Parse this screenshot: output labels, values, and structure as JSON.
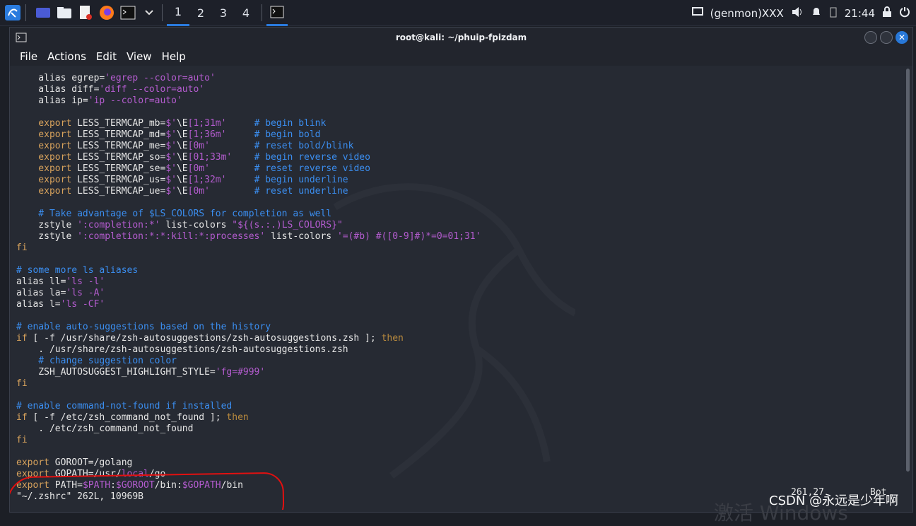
{
  "taskbar": {
    "workspaces": [
      "1",
      "2",
      "3",
      "4"
    ],
    "active_workspace": "1",
    "genmon": "(genmon)XXX",
    "clock": "21:44"
  },
  "window": {
    "title": "root@kali: ~/phuip-fpizdam",
    "menu": [
      "File",
      "Actions",
      "Edit",
      "View",
      "Help"
    ]
  },
  "lines": [
    [
      [
        "    alias egrep=",
        ""
      ],
      [
        "'egrep --color=auto'",
        "s"
      ]
    ],
    [
      [
        "    alias diff=",
        ""
      ],
      [
        "'diff --color=auto'",
        "s"
      ]
    ],
    [
      [
        "    alias ip=",
        ""
      ],
      [
        "'ip --color=auto'",
        "s"
      ]
    ],
    [],
    [
      [
        "    export ",
        "k"
      ],
      [
        "LESS_TERMCAP_mb=",
        ""
      ],
      [
        "$'",
        "s"
      ],
      [
        "\\E",
        ""
      ],
      [
        "[1;31m'",
        "s"
      ],
      [
        "     ",
        ""
      ],
      [
        "# begin blink",
        "c"
      ]
    ],
    [
      [
        "    export ",
        "k"
      ],
      [
        "LESS_TERMCAP_md=",
        ""
      ],
      [
        "$'",
        "s"
      ],
      [
        "\\E",
        ""
      ],
      [
        "[1;36m'",
        "s"
      ],
      [
        "     ",
        ""
      ],
      [
        "# begin bold",
        "c"
      ]
    ],
    [
      [
        "    export ",
        "k"
      ],
      [
        "LESS_TERMCAP_me=",
        ""
      ],
      [
        "$'",
        "s"
      ],
      [
        "\\E",
        ""
      ],
      [
        "[0m'",
        "s"
      ],
      [
        "        ",
        ""
      ],
      [
        "# reset bold/blink",
        "c"
      ]
    ],
    [
      [
        "    export ",
        "k"
      ],
      [
        "LESS_TERMCAP_so=",
        ""
      ],
      [
        "$'",
        "s"
      ],
      [
        "\\E",
        ""
      ],
      [
        "[01;33m'",
        "s"
      ],
      [
        "    ",
        ""
      ],
      [
        "# begin reverse video",
        "c"
      ]
    ],
    [
      [
        "    export ",
        "k"
      ],
      [
        "LESS_TERMCAP_se=",
        ""
      ],
      [
        "$'",
        "s"
      ],
      [
        "\\E",
        ""
      ],
      [
        "[0m'",
        "s"
      ],
      [
        "        ",
        ""
      ],
      [
        "# reset reverse video",
        "c"
      ]
    ],
    [
      [
        "    export ",
        "k"
      ],
      [
        "LESS_TERMCAP_us=",
        ""
      ],
      [
        "$'",
        "s"
      ],
      [
        "\\E",
        ""
      ],
      [
        "[1;32m'",
        "s"
      ],
      [
        "     ",
        ""
      ],
      [
        "# begin underline",
        "c"
      ]
    ],
    [
      [
        "    export ",
        "k"
      ],
      [
        "LESS_TERMCAP_ue=",
        ""
      ],
      [
        "$'",
        "s"
      ],
      [
        "\\E",
        ""
      ],
      [
        "[0m'",
        "s"
      ],
      [
        "        ",
        ""
      ],
      [
        "# reset underline",
        "c"
      ]
    ],
    [],
    [
      [
        "    # Take advantage of $LS_COLORS for completion as well",
        "c"
      ]
    ],
    [
      [
        "    zstyle ",
        ""
      ],
      [
        "':completion:*'",
        "s"
      ],
      [
        " list-colors ",
        ""
      ],
      [
        "\"${(s.:.)LS_COLORS}\"",
        "s"
      ]
    ],
    [
      [
        "    zstyle ",
        ""
      ],
      [
        "':completion:*:*:kill:*:processes'",
        "s"
      ],
      [
        " list-colors ",
        ""
      ],
      [
        "'=(#b) #([0-9]#)*=0=01;31'",
        "s"
      ]
    ],
    [
      [
        "fi",
        "k"
      ]
    ],
    [],
    [
      [
        "# some more ls aliases",
        "c"
      ]
    ],
    [
      [
        "alias ll=",
        ""
      ],
      [
        "'ls -l'",
        "s"
      ]
    ],
    [
      [
        "alias la=",
        ""
      ],
      [
        "'ls -A'",
        "s"
      ]
    ],
    [
      [
        "alias l=",
        ""
      ],
      [
        "'ls -CF'",
        "s"
      ]
    ],
    [],
    [
      [
        "# enable auto-suggestions based on the history",
        "c"
      ]
    ],
    [
      [
        "if",
        "k"
      ],
      [
        " [ -f /usr/share/zsh-autosuggestions/zsh-autosuggestions.zsh ]; ",
        ""
      ],
      [
        "then",
        "o"
      ]
    ],
    [
      [
        "    . /usr/share/zsh-autosuggestions/zsh-autosuggestions.zsh",
        ""
      ]
    ],
    [
      [
        "    # change suggestion color",
        "c"
      ]
    ],
    [
      [
        "    ZSH_AUTOSUGGEST_HIGHLIGHT_STYLE=",
        ""
      ],
      [
        "'fg=#999'",
        "s"
      ]
    ],
    [
      [
        "fi",
        "k"
      ]
    ],
    [],
    [
      [
        "# enable command-not-found if installed",
        "c"
      ]
    ],
    [
      [
        "if",
        "k"
      ],
      [
        " [ -f /etc/zsh_command_not_found ]; ",
        ""
      ],
      [
        "then",
        "o"
      ]
    ],
    [
      [
        "    . /etc/zsh_command_not_found",
        ""
      ]
    ],
    [
      [
        "fi",
        "k"
      ]
    ],
    [],
    [
      [
        "export ",
        "k"
      ],
      [
        "GOROOT=/golang",
        ""
      ]
    ],
    [
      [
        "export ",
        "k"
      ],
      [
        "GOPATH=/usr/",
        ""
      ],
      [
        "local",
        "s"
      ],
      [
        "/go",
        ""
      ]
    ],
    [
      [
        "export ",
        "k"
      ],
      [
        "PATH=",
        ""
      ],
      [
        "$PATH",
        "s"
      ],
      [
        ":",
        ""
      ],
      [
        "$GOROOT",
        "s"
      ],
      [
        "/bin:",
        ""
      ],
      [
        "$GOPATH",
        "s"
      ],
      [
        "/bin",
        ""
      ]
    ],
    [
      [
        "\"~/.zshrc\" 262L, 10969B",
        ""
      ]
    ]
  ],
  "status": {
    "position": "261,27",
    "scroll": "Bot"
  },
  "watermark": "CSDN @永远是少年啊",
  "activation": "激活 Windows"
}
